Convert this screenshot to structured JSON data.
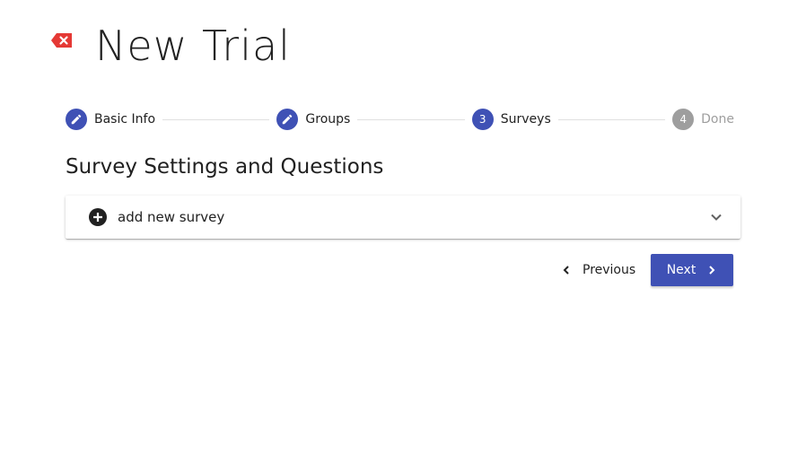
{
  "header": {
    "title": "New Trial",
    "close_icon": "backspace-x-icon",
    "close_color": "#e53935"
  },
  "stepper": {
    "steps": [
      {
        "label": "Basic Info",
        "icon": "pencil-icon",
        "state": "completed"
      },
      {
        "label": "Groups",
        "icon": "pencil-icon",
        "state": "completed"
      },
      {
        "label": "Surveys",
        "number": "3",
        "state": "active"
      },
      {
        "label": "Done",
        "number": "4",
        "state": "disabled"
      }
    ],
    "active_color": "#3f51b5",
    "disabled_color": "#9e9e9e"
  },
  "main": {
    "section_title": "Survey Settings and Questions",
    "panel": {
      "label": "add new survey",
      "icon": "plus-circle-icon",
      "expand_icon": "chevron-down-icon"
    }
  },
  "actions": {
    "previous_label": "Previous",
    "next_label": "Next",
    "next_color": "#3f51b5"
  }
}
